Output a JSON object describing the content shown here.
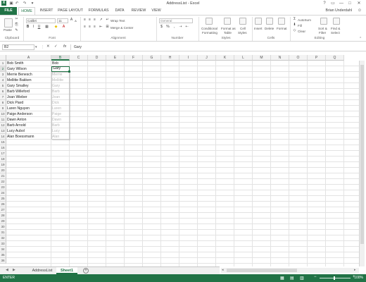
{
  "window": {
    "title": "AddressList - Excel",
    "controls": [
      "?",
      "▭",
      "—",
      "□",
      "✕"
    ]
  },
  "quick_access": {
    "save_icon": "save-icon",
    "undo_icon": "undo-icon",
    "redo_icon": "redo-icon"
  },
  "tabs": [
    "FILE",
    "HOME",
    "INSERT",
    "PAGE LAYOUT",
    "FORMULAS",
    "DATA",
    "REVIEW",
    "VIEW"
  ],
  "user": "Brian Underdahl",
  "ribbon": {
    "clipboard": {
      "label": "Clipboard",
      "paste": "Paste"
    },
    "font": {
      "label": "Font",
      "name": "Calibri",
      "size": "11",
      "bold": "B",
      "italic": "I",
      "underline": "U"
    },
    "alignment": {
      "label": "Alignment",
      "wrap": "Wrap Text",
      "merge": "Merge & Center"
    },
    "number": {
      "label": "Number",
      "format": "General",
      "currency": "$",
      "percent": "%",
      "comma": ","
    },
    "styles": {
      "label": "Styles",
      "conditional": "Conditional",
      "conditional2": "Formatting",
      "format_as": "Format as",
      "format_as2": "Table",
      "cell": "Cell",
      "cell2": "Styles"
    },
    "cells": {
      "label": "Cells",
      "insert": "Insert",
      "delete": "Delete",
      "format": "Format"
    },
    "editing": {
      "label": "Editing",
      "autosum": "AutoSum",
      "fill": "Fill",
      "clear": "Clear",
      "sort": "Sort &",
      "sort2": "Filter",
      "find": "Find &",
      "find2": "Select"
    }
  },
  "formula_bar": {
    "name_box": "B2",
    "cancel": "✕",
    "enter": "✓",
    "fx": "fx",
    "content": "Gary"
  },
  "columns": [
    "A",
    "B",
    "C",
    "D",
    "E",
    "F",
    "G",
    "H",
    "I",
    "J",
    "K",
    "L",
    "M",
    "N",
    "O",
    "P",
    "Q"
  ],
  "rows": [
    "1",
    "2",
    "3",
    "4",
    "5",
    "6",
    "7",
    "8",
    "9",
    "10",
    "11",
    "12",
    "13",
    "14",
    "15",
    "16",
    "17",
    "18",
    "19",
    "20",
    "21",
    "22",
    "23",
    "24",
    "25",
    "26",
    "27",
    "28",
    "29",
    "30",
    "31",
    "32",
    "33",
    "34",
    "35",
    "36"
  ],
  "column_a": [
    "Bob Smith",
    "Gary Wilson",
    "Merrie Benesch",
    "Mellitte Bakken",
    "Gary Smalley",
    "Barb Willeford",
    "Joan Wieber",
    "Dick Piard",
    "Laren Nguyen",
    "Paige Anderson",
    "Dawn Anton",
    "Barb Arnold",
    "Lucy Aubol",
    "Alan Boessmann"
  ],
  "column_b": [
    "Bob",
    "Gary",
    "Merrie",
    "Mellitte",
    "Gary",
    "Barb",
    "Joan",
    "Dick",
    "Laren",
    "Paige",
    "Dawn",
    "Barb",
    "Lucy",
    "Alan"
  ],
  "sheets": [
    "AddressList",
    "Sheet1"
  ],
  "active_sheet": "Sheet1",
  "status": {
    "mode": "ENTER",
    "zoom": "100%"
  },
  "colors": {
    "accent": "#217346",
    "ghost_text": "#b7b7b7"
  }
}
